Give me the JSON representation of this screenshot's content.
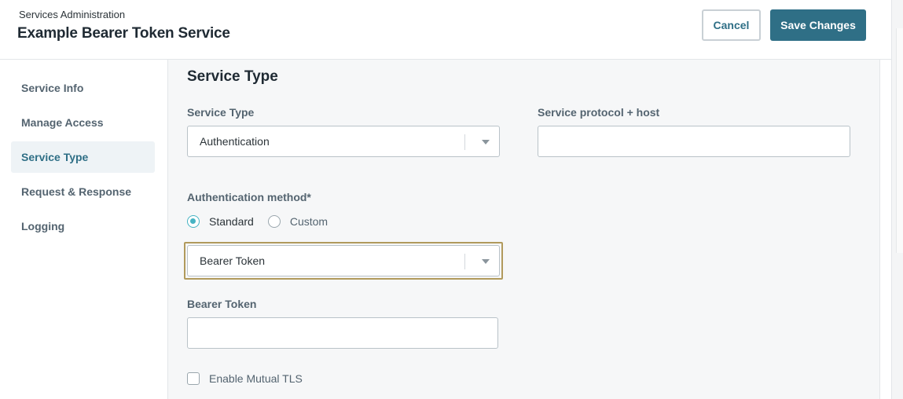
{
  "header": {
    "breadcrumb": "Services Administration",
    "title": "Example Bearer Token Service",
    "cancel_label": "Cancel",
    "save_label": "Save Changes"
  },
  "sidebar": {
    "items": [
      {
        "label": "Service Info",
        "active": false
      },
      {
        "label": "Manage Access",
        "active": false
      },
      {
        "label": "Service Type",
        "active": true
      },
      {
        "label": "Request & Response",
        "active": false
      },
      {
        "label": "Logging",
        "active": false
      }
    ]
  },
  "main": {
    "section_title": "Service Type",
    "service_type": {
      "label": "Service Type",
      "value": "Authentication"
    },
    "protocol_host": {
      "label": "Service protocol + host",
      "value": ""
    },
    "auth_method": {
      "label": "Authentication method*",
      "options": [
        "Standard",
        "Custom"
      ],
      "selected": "Standard",
      "select_value": "Bearer Token"
    },
    "bearer_token": {
      "label": "Bearer Token",
      "value": ""
    },
    "mutual_tls": {
      "label": "Enable Mutual TLS",
      "checked": false
    }
  },
  "colors": {
    "accent": "#2f6f86",
    "radio_accent": "#46b3c3",
    "focus_ring": "#b19a5c",
    "main_bg": "#f6f7f8"
  }
}
